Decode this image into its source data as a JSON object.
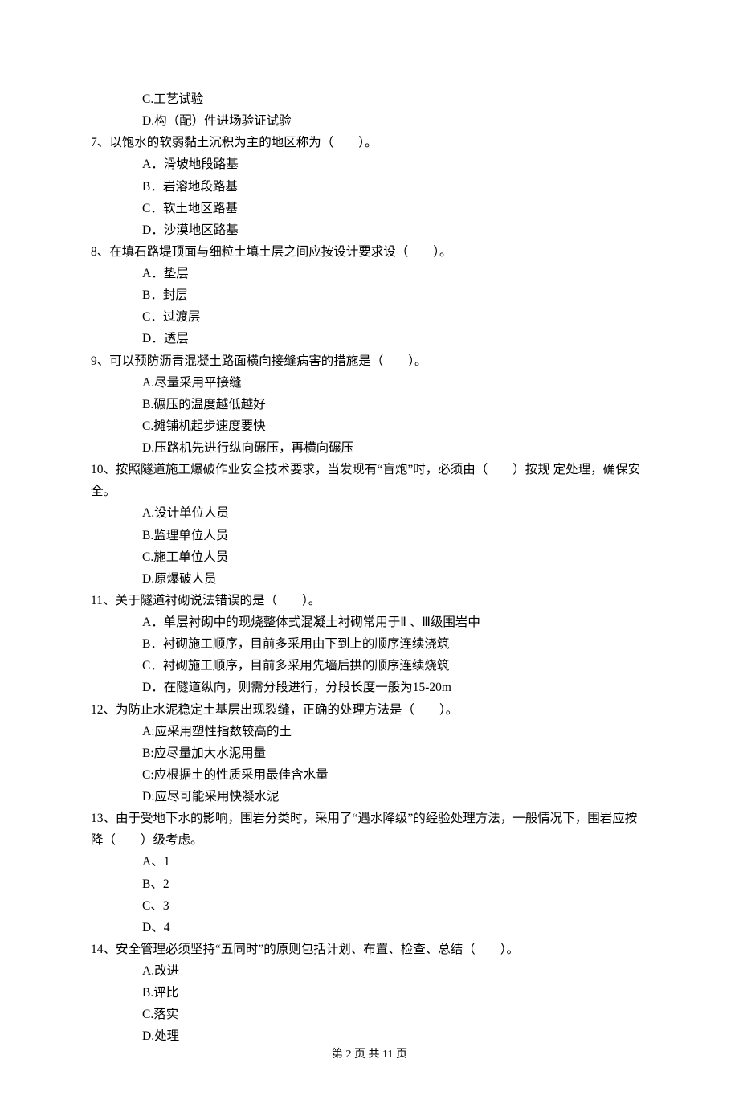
{
  "prelude_options": [
    "C.工艺试验",
    "D.构（配）件进场验证试验"
  ],
  "questions": [
    {
      "num": "7",
      "stem": "以饱水的软弱黏土沉积为主的地区称为（　　）。",
      "options": [
        "A．滑坡地段路基",
        "B．岩溶地段路基",
        "C．软土地区路基",
        "D．沙漠地区路基"
      ]
    },
    {
      "num": "8",
      "stem": "在填石路堤顶面与细粒土填土层之间应按设计要求设（　　）。",
      "options": [
        "A．垫层",
        "B．封层",
        "C．过渡层",
        "D．透层"
      ]
    },
    {
      "num": "9",
      "stem": "可以预防沥青混凝土路面横向接缝病害的措施是（　　）。",
      "options": [
        "A.尽量采用平接缝",
        "B.碾压的温度越低越好",
        "C.摊铺机起步速度要快",
        "D.压路机先进行纵向碾压，再横向碾压"
      ]
    },
    {
      "num": "10",
      "stem": "按照隧道施工爆破作业安全技术要求，当发现有“盲炮”时，必须由（　　）按规 定处理，确保安全。",
      "options": [
        "A.设计单位人员",
        "B.监理单位人员",
        "C.施工单位人员",
        "D.原爆破人员"
      ]
    },
    {
      "num": "11",
      "stem": "关于隧道衬砌说法错误的是（　　）。",
      "options": [
        "A．单层衬砌中的现烧整体式混凝土衬砌常用于Ⅱ 、Ⅲ级围岩中",
        "B．衬砌施工顺序，目前多采用由下到上的顺序连续浇筑",
        "C．衬砌施工顺序，目前多采用先墙后拱的顺序连续烧筑",
        "D．在隧道纵向，则需分段进行，分段长度一般为15-20m"
      ]
    },
    {
      "num": "12",
      "stem": "为防止水泥稳定土基层出现裂缝，正确的处理方法是（　　）。",
      "options": [
        "A:应采用塑性指数较高的土",
        "B:应尽量加大水泥用量",
        "C:应根据土的性质采用最佳含水量",
        "D:应尽可能采用快凝水泥"
      ]
    },
    {
      "num": "13",
      "stem": "由于受地下水的影响，围岩分类时，采用了“遇水降级”的经验处理方法，一般情况下，围岩应按降（　　）级考虑。",
      "options": [
        "A、1",
        "B、2",
        "C、3",
        "D、4"
      ]
    },
    {
      "num": "14",
      "stem": "安全管理必须坚持“五同时”的原则包括计划、布置、检查、总结（　　）。",
      "options": [
        "A.改进",
        "B.评比",
        "C.落实",
        "D.处理"
      ]
    }
  ],
  "footer": "第 2 页 共 11 页"
}
